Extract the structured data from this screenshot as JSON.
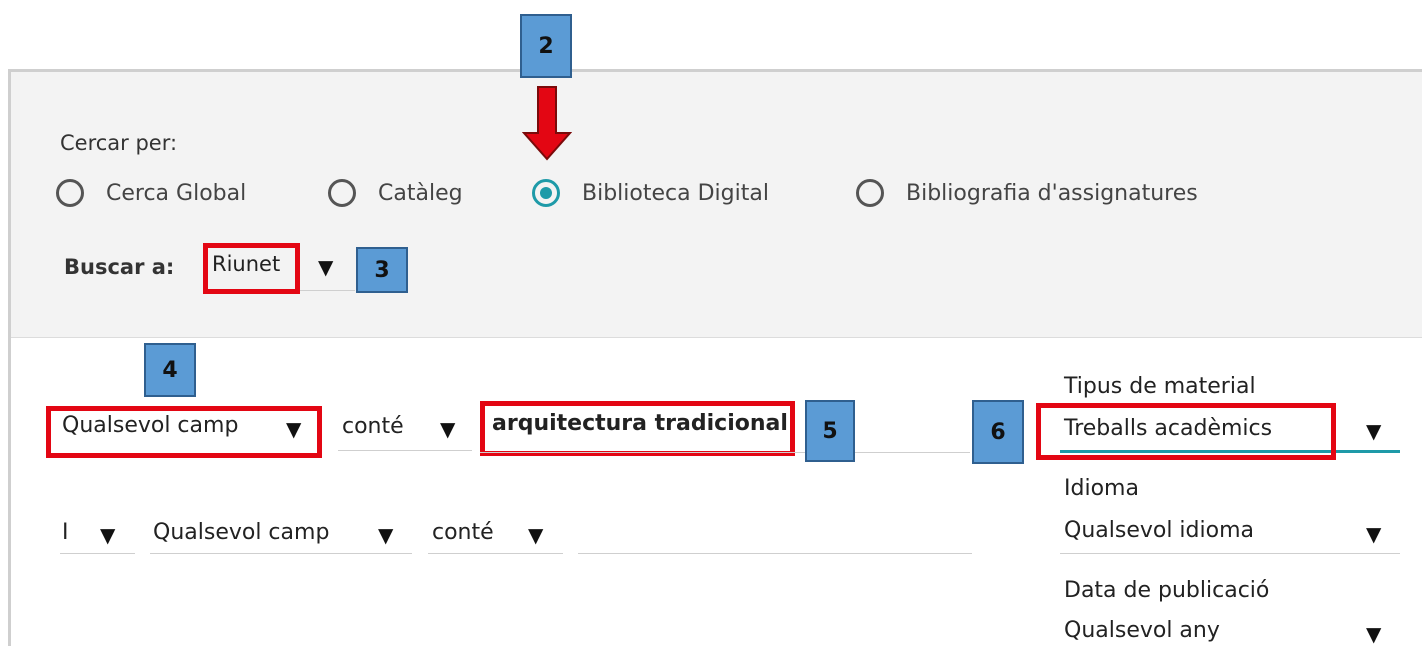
{
  "search_by": {
    "label": "Cercar per:",
    "options": [
      {
        "label": "Cerca Global",
        "selected": false
      },
      {
        "label": "Catàleg",
        "selected": false
      },
      {
        "label": "Biblioteca Digital",
        "selected": true
      },
      {
        "label": "Bibliografia d'assignatures",
        "selected": false
      }
    ]
  },
  "search_in": {
    "label": "Buscar a:",
    "value": "Riunet"
  },
  "query_row1": {
    "field": "Qualsevol camp",
    "operator": "conté",
    "value": "arquitectura tradicional"
  },
  "query_row2": {
    "boolean": "I",
    "field": "Qualsevol camp",
    "operator": "conté",
    "value": ""
  },
  "filters": {
    "material": {
      "label": "Tipus de material",
      "value": "Treballs acadèmics"
    },
    "language": {
      "label": "Idioma",
      "value": "Qualsevol idioma"
    },
    "date": {
      "label": "Data de publicació",
      "value": "Qualsevol any"
    }
  },
  "annotations": {
    "n2": "2",
    "n3": "3",
    "n4": "4",
    "n5": "5",
    "n6": "6"
  },
  "colors": {
    "accent": "#1e9aa8",
    "highlight": "#e30613",
    "badge": "#5b9bd5"
  }
}
